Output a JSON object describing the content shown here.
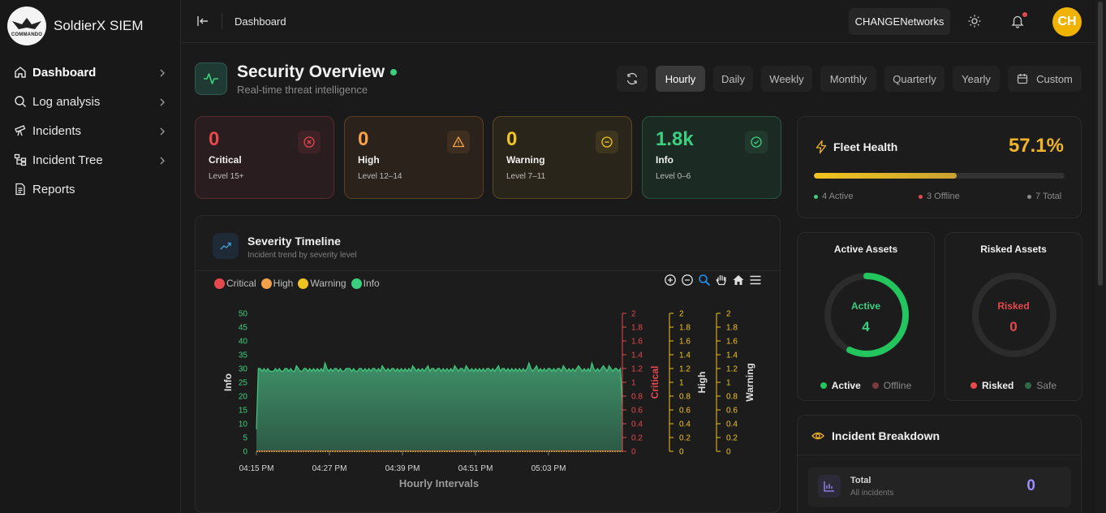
{
  "brand": {
    "name": "SoldierX SIEM",
    "logo_text": "COMMANDO"
  },
  "sidebar": {
    "items": [
      {
        "label": "Dashboard",
        "icon": "home-icon",
        "active": true
      },
      {
        "label": "Log analysis",
        "icon": "search-icon"
      },
      {
        "label": "Incidents",
        "icon": "telescope-icon"
      },
      {
        "label": "Incident Tree",
        "icon": "tree-icon"
      },
      {
        "label": "Reports",
        "icon": "document-icon"
      }
    ]
  },
  "topbar": {
    "breadcrumb": "Dashboard",
    "org": "CHANGENetworks",
    "avatar": "CH"
  },
  "overview": {
    "title": "Security Overview",
    "subtitle": "Real-time threat intelligence",
    "periods": [
      "Hourly",
      "Daily",
      "Weekly",
      "Monthly",
      "Quarterly",
      "Yearly",
      "Custom"
    ],
    "active_period": "Hourly"
  },
  "severity_cards": [
    {
      "value": "0",
      "label": "Critical",
      "level": "Level 15+",
      "color": "#e5484d"
    },
    {
      "value": "0",
      "label": "High",
      "level": "Level 12–14",
      "color": "#f5a04a"
    },
    {
      "value": "0",
      "label": "Warning",
      "level": "Level 7–11",
      "color": "#f0c420"
    },
    {
      "value": "1.8k",
      "label": "Info",
      "level": "Level 0–6",
      "color": "#3ccf7f"
    }
  ],
  "timeline": {
    "title": "Severity Timeline",
    "subtitle": "Incident trend by severity level"
  },
  "chart_data": {
    "type": "area",
    "xlabel": "Hourly Intervals",
    "x_ticks": [
      "04:15 PM",
      "04:27 PM",
      "04:39 PM",
      "04:51 PM",
      "05:03 PM"
    ],
    "legend": [
      "Critical",
      "High",
      "Warning",
      "Info"
    ],
    "colors": {
      "Critical": "#e5484d",
      "High": "#f5a04a",
      "Warning": "#f0c420",
      "Info": "#3ccf7f"
    },
    "axes": [
      {
        "label": "Info",
        "ticks": [
          "50",
          "45",
          "40",
          "35",
          "30",
          "25",
          "20",
          "15",
          "10",
          "5",
          "0"
        ],
        "ylim": [
          0,
          50
        ],
        "color": "#3ccf7f"
      },
      {
        "label": "Critical",
        "ticks": [
          "2",
          "1.8",
          "1.6",
          "1.4",
          "1.2",
          "1",
          "0.8",
          "0.6",
          "0.4",
          "0.2",
          "0"
        ],
        "ylim": [
          0,
          2
        ],
        "color": "#e5484d"
      },
      {
        "label": "High",
        "ticks": [
          "2",
          "1.8",
          "1.6",
          "1.4",
          "1.2",
          "1",
          "0.8",
          "0.6",
          "0.4",
          "0.2",
          "0"
        ],
        "ylim": [
          0,
          2
        ],
        "color": "#f0c420"
      },
      {
        "label": "Warning",
        "ticks": [
          "2",
          "1.8",
          "1.6",
          "1.4",
          "1.2",
          "1",
          "0.8",
          "0.6",
          "0.4",
          "0.2",
          "0"
        ],
        "ylim": [
          0,
          2
        ],
        "color": "#f0c420"
      }
    ],
    "series": [
      {
        "name": "Info",
        "values": [
          8,
          30,
          30,
          29,
          30,
          29,
          30,
          29,
          29,
          29,
          30,
          29,
          30,
          29,
          29,
          30,
          30,
          29,
          30,
          29,
          29,
          31,
          30,
          29,
          29,
          30,
          30,
          29,
          30,
          29,
          30,
          29,
          30,
          29,
          30,
          29,
          32,
          30,
          29,
          30,
          29,
          30,
          30,
          29,
          30,
          29,
          29,
          30,
          30,
          30,
          29,
          30,
          29,
          29,
          30,
          30,
          29,
          30,
          29,
          30,
          29,
          30,
          30,
          29,
          30,
          29,
          31,
          30,
          29,
          30,
          29,
          30,
          30,
          29,
          30,
          29,
          30,
          29,
          30,
          29,
          30,
          29,
          31,
          30,
          29,
          30,
          29,
          30,
          29,
          30,
          31,
          29,
          30,
          30,
          29,
          30,
          30,
          29,
          30,
          29,
          30,
          29,
          30,
          29,
          31,
          30,
          29,
          30,
          30,
          29,
          31,
          30,
          29,
          30,
          29,
          30,
          29,
          30,
          29,
          30,
          29,
          30,
          30,
          29,
          30,
          29,
          30,
          31,
          29,
          30,
          30,
          29,
          30,
          29,
          30,
          29,
          30,
          29,
          30,
          29,
          30,
          29,
          30,
          32,
          30,
          29,
          30,
          31,
          29,
          30,
          29,
          30,
          29,
          30,
          30,
          29,
          30,
          29,
          30,
          30,
          29,
          31,
          30,
          29,
          30,
          29,
          30,
          29,
          30,
          31,
          30,
          29,
          30,
          29,
          30,
          29,
          32,
          30,
          29,
          30,
          29,
          30,
          31,
          30,
          29,
          31,
          30,
          29,
          30,
          30,
          29,
          30,
          17
        ]
      },
      {
        "name": "Critical",
        "values": [
          0,
          0
        ]
      },
      {
        "name": "High",
        "values": [
          0,
          0
        ]
      },
      {
        "name": "Warning",
        "values": [
          0,
          0
        ]
      }
    ]
  },
  "fleet": {
    "title": "Fleet Health",
    "percent": "57.1%",
    "fill": 0.571,
    "active": "4 Active",
    "offline": "3 Offline",
    "total": "7 Total"
  },
  "active_assets": {
    "title": "Active Assets",
    "ring_label": "Active",
    "value": "4",
    "fraction": 0.571,
    "legend_a": "Active",
    "legend_b": "Offline"
  },
  "risked_assets": {
    "title": "Risked Assets",
    "ring_label": "Risked",
    "value": "0",
    "fraction": 0,
    "legend_a": "Risked",
    "legend_b": "Safe"
  },
  "breakdown": {
    "title": "Incident Breakdown",
    "row_label": "Total",
    "row_sub": "All incidents",
    "row_value": "0"
  }
}
